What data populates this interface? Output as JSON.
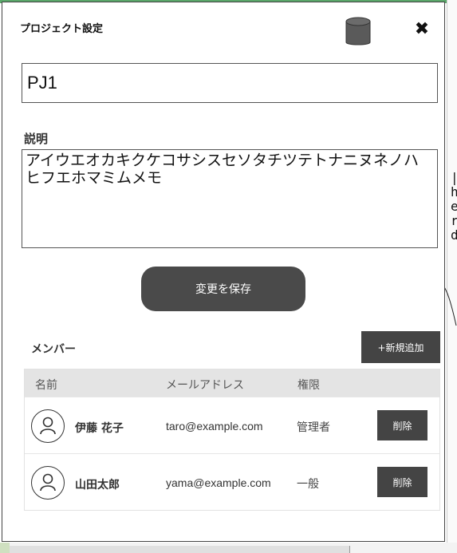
{
  "modal": {
    "title": "プロジェクト設定",
    "icons": {
      "database": "database-icon",
      "close": "close-icon"
    },
    "close_glyph": "✖"
  },
  "project": {
    "name": "PJ1",
    "description_label": "説明",
    "description": "アイウエオカキクケコサシスセソタチツテトナニヌネノハヒフエホマミムメモ"
  },
  "actions": {
    "save_label": "変更を保存"
  },
  "members": {
    "label": "メンバー",
    "add_label": "+新規追加",
    "columns": [
      "名前",
      "メールアドレス",
      "権限"
    ],
    "rows": [
      {
        "name": "伊藤 花子",
        "email": "taro@example.com",
        "role": "管理者",
        "delete_label": "削除"
      },
      {
        "name": "山田太郎",
        "email": "yama@example.com",
        "role": "一般",
        "delete_label": "削除"
      }
    ]
  },
  "colors": {
    "dark_button": "#444444",
    "header_bg": "#e4e4e4",
    "accent_top": "#5aa86a"
  }
}
